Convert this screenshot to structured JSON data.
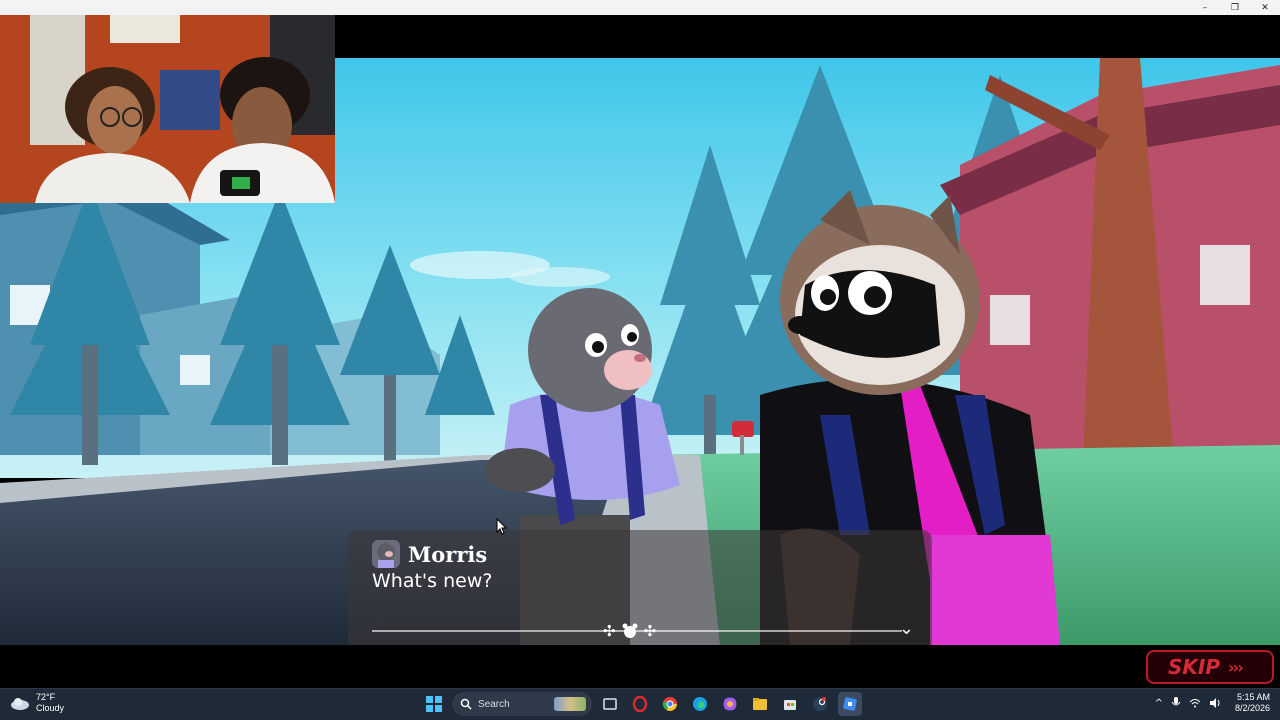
{
  "window": {
    "controls": {
      "minimize": "–",
      "maximize": "❐",
      "close": "✕"
    }
  },
  "dialog": {
    "speaker": "Morris",
    "text": "What's new?",
    "next_glyph": "⌄",
    "ornament": [
      "✣",
      "✣"
    ]
  },
  "skip": {
    "label": "SKIP",
    "arrows": "›››"
  },
  "taskbar": {
    "weather": {
      "temp": "72°F",
      "condition": "Cloudy"
    },
    "search_placeholder": "Search",
    "tray": {
      "chevron": "^"
    },
    "clock": {
      "time": "5:15 AM",
      "date": "8/2/2026"
    }
  },
  "colors": {
    "sky": "#5fd3ee",
    "skip_accent": "#d62a3a",
    "taskbar": "#1f2a38"
  }
}
